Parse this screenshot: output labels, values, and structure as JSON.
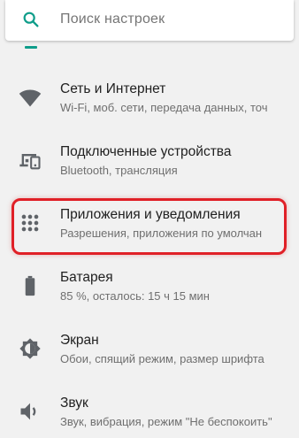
{
  "search": {
    "placeholder": "Поиск настроек",
    "icon": "search-icon",
    "accent": "#0f9d8a"
  },
  "highlight_color": "#e02027",
  "items": [
    {
      "icon": "wifi-icon",
      "title": "Сеть и Интернет",
      "subtitle": "Wi-Fi, моб. сети, передача данных, точ"
    },
    {
      "icon": "connected-devices-icon",
      "title": "Подключенные устройства",
      "subtitle": "Bluetooth, трансляция"
    },
    {
      "icon": "apps-grid-icon",
      "title": "Приложения и уведомления",
      "subtitle": "Разрешения, приложения по умолчан"
    },
    {
      "icon": "battery-icon",
      "title": "Батарея",
      "subtitle": "85 %, осталось: 15 ч 15 мин"
    },
    {
      "icon": "brightness-icon",
      "title": "Экран",
      "subtitle": "Обои, спящий режим, размер шрифта"
    },
    {
      "icon": "volume-icon",
      "title": "Звук",
      "subtitle": "Звук, вибрация, режим \"Не беспокоить\""
    }
  ]
}
